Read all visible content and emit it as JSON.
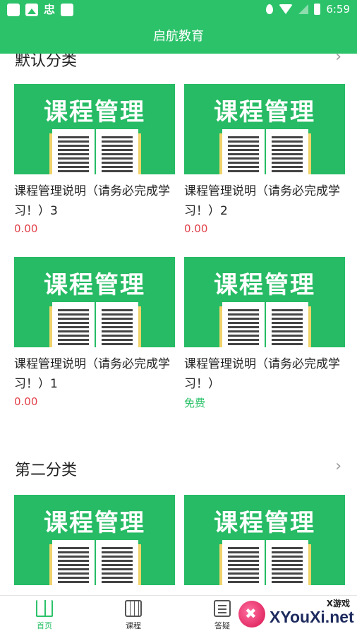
{
  "status_bar": {
    "time": "6:59",
    "glyph": "忠"
  },
  "header": {
    "title": "启航教育"
  },
  "sections": [
    {
      "title": "默认分类",
      "cards": [
        {
          "thumb_text": "课程管理",
          "name": "课程管理说明（请务必完成学习！）3",
          "price": "0.00",
          "price_type": "paid"
        },
        {
          "thumb_text": "课程管理",
          "name": "课程管理说明（请务必完成学习！）2",
          "price": "0.00",
          "price_type": "paid"
        },
        {
          "thumb_text": "课程管理",
          "name": "课程管理说明（请务必完成学习！）1",
          "price": "0.00",
          "price_type": "paid"
        },
        {
          "thumb_text": "课程管理",
          "name": "课程管理说明（请务必完成学习！）",
          "price": "免费",
          "price_type": "free"
        }
      ]
    },
    {
      "title": "第二分类",
      "cards": [
        {
          "thumb_text": "课程管理"
        },
        {
          "thumb_text": "课程管理"
        }
      ]
    }
  ],
  "bottom_nav": [
    {
      "label": "首页",
      "icon": "book-open-icon",
      "active": true
    },
    {
      "label": "课程",
      "icon": "calendar-icon",
      "active": false
    },
    {
      "label": "答疑",
      "icon": "qa-icon",
      "active": false
    }
  ],
  "watermark": {
    "top_text": "X游戏",
    "main_text": "XYouXi.net"
  },
  "colors": {
    "brand": "#2cc26a",
    "price": "#e2414a"
  }
}
